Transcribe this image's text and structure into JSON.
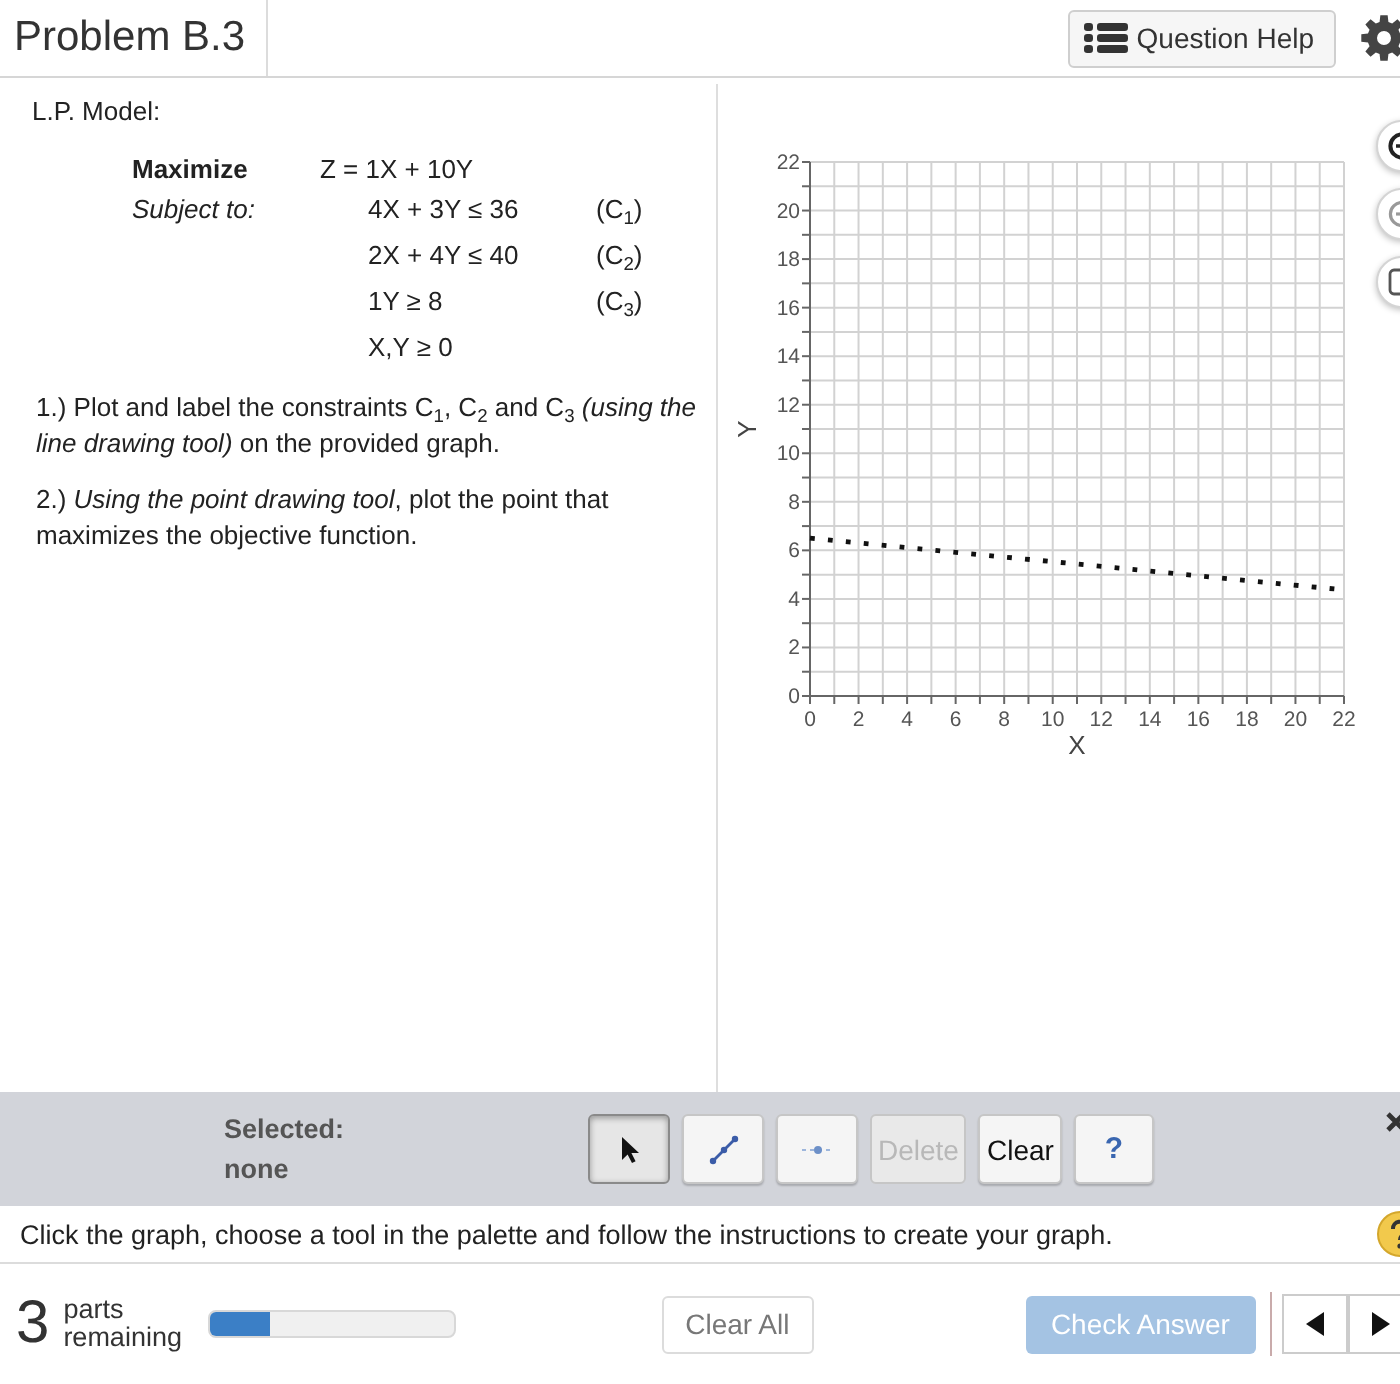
{
  "header": {
    "title": "Problem B.3",
    "help_button": "Question Help"
  },
  "problem": {
    "heading": "L.P. Model:",
    "objective": {
      "label": "Maximize",
      "expression": "Z = 1X + 10Y"
    },
    "constraints_label": "Subject to:",
    "constraints": [
      {
        "expression": "4X + 3Y ≤ 36",
        "tag": "(C$_{1}$)"
      },
      {
        "expression": "2X + 4Y ≤ 40",
        "tag": "(C$_{2}$)"
      },
      {
        "expression": "1Y ≥ 8",
        "tag": "(C$_{3}$)"
      },
      {
        "expression": "X,Y ≥ 0"
      }
    ],
    "instructions": [
      "1.) Plot and label the constraints C$_{1}$, C$_{2}$ and C$_{3}$ *(using the line drawing tool)* on the provided graph.",
      "2.) *Using the point drawing tool*, plot the point that maximizes the objective function."
    ]
  },
  "graph": {
    "chart_data": {
      "type": "line",
      "xlabel": "X",
      "ylabel": "Y",
      "grid": true,
      "x": [
        0,
        21.7
      ],
      "series": [
        {
          "color": "#111111",
          "line_style": "dotted",
          "values": [
            6.5,
            4.4
          ]
        }
      ],
      "xlim": [
        0,
        22
      ],
      "ylim": [
        0,
        22
      ],
      "xticks": [
        0,
        2,
        4,
        6,
        8,
        10,
        12,
        14,
        16,
        18,
        20,
        22
      ],
      "yticks": [
        0,
        2,
        4,
        6,
        8,
        10,
        12,
        14,
        16,
        18,
        20,
        22
      ]
    }
  },
  "toolbar": {
    "selected_label": "Selected:",
    "selected_value": "none",
    "tools": [
      {
        "kind": "pointer",
        "selected": true
      },
      {
        "kind": "line",
        "selected": false
      },
      {
        "kind": "point",
        "selected": false
      }
    ],
    "actions": [
      {
        "kind": "delete",
        "label": "Delete",
        "disabled": true
      },
      {
        "kind": "clear",
        "label": "Clear",
        "disabled": false
      },
      {
        "kind": "help",
        "label": "?",
        "disabled": false
      }
    ]
  },
  "instruction": "Click the graph, choose a tool in the palette and follow the instructions to create your graph.",
  "footer": {
    "parts_count": "3",
    "parts_label": "parts remaining",
    "progress": {
      "level": 0.25
    },
    "clear_all": "Clear All",
    "check_answer": {
      "label": "Check Answer",
      "disabled": true
    }
  }
}
